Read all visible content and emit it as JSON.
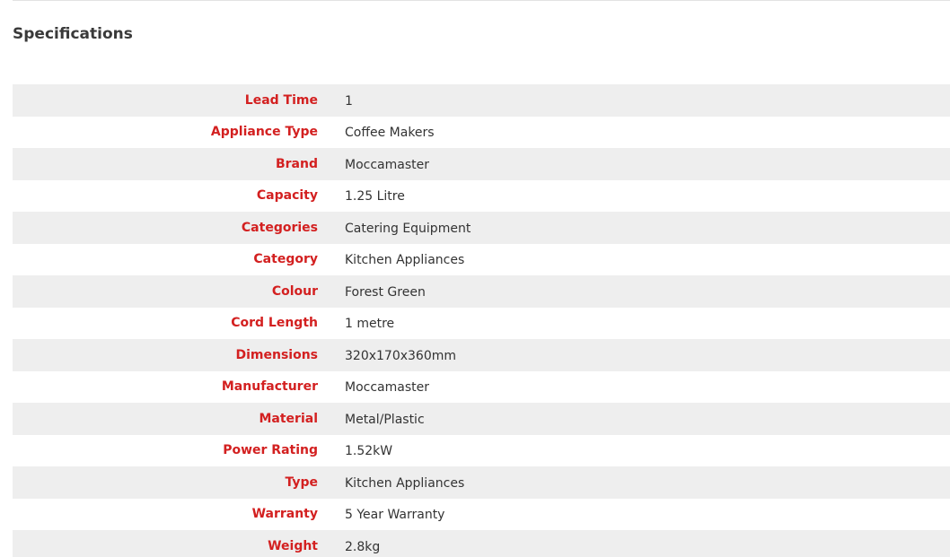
{
  "section": {
    "title": "Specifications"
  },
  "specs": [
    {
      "label": "Lead Time",
      "value": "1"
    },
    {
      "label": "Appliance Type",
      "value": "Coffee Makers"
    },
    {
      "label": "Brand",
      "value": "Moccamaster"
    },
    {
      "label": "Capacity",
      "value": "1.25 Litre"
    },
    {
      "label": "Categories",
      "value": "Catering Equipment"
    },
    {
      "label": "Category",
      "value": "Kitchen Appliances"
    },
    {
      "label": "Colour",
      "value": "Forest Green"
    },
    {
      "label": "Cord Length",
      "value": "1 metre"
    },
    {
      "label": "Dimensions",
      "value": "320x170x360mm"
    },
    {
      "label": "Manufacturer",
      "value": "Moccamaster"
    },
    {
      "label": "Material",
      "value": "Metal/Plastic"
    },
    {
      "label": "Power Rating",
      "value": "1.52kW"
    },
    {
      "label": "Type",
      "value": "Kitchen Appliances"
    },
    {
      "label": "Warranty",
      "value": "5 Year Warranty"
    },
    {
      "label": "Weight",
      "value": "2.8kg"
    }
  ],
  "colors": {
    "label": "#d32020",
    "value": "#333333",
    "title": "#3a3a3a",
    "row_shade": "#eeeeee"
  }
}
